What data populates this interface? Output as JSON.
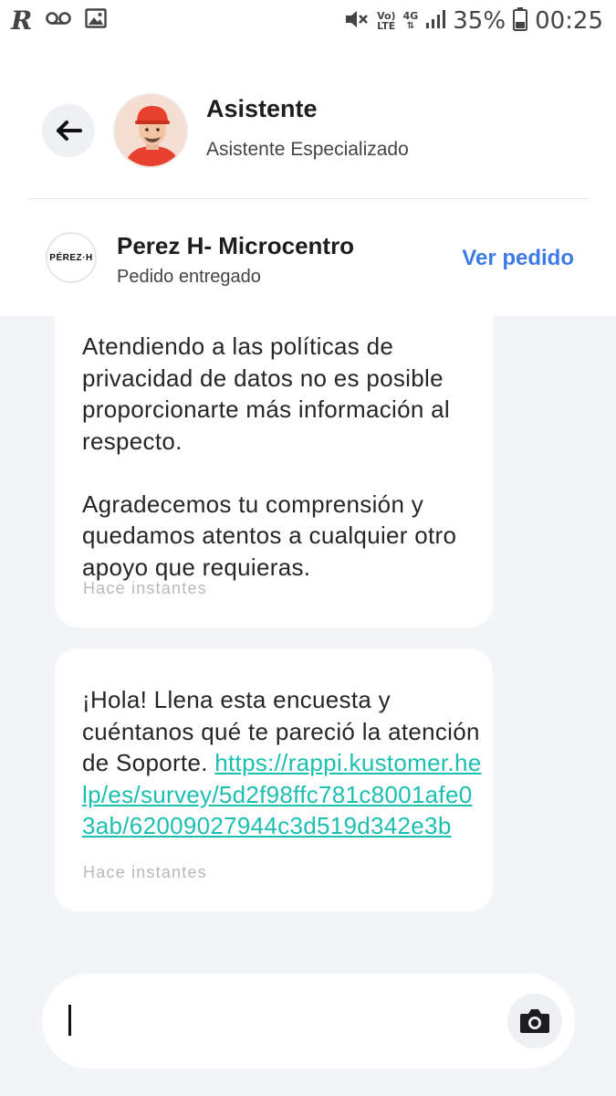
{
  "status_bar": {
    "battery": "35%",
    "time": "00:25",
    "network_4g": "4G",
    "volte_top": "Vo)",
    "volte_bottom": "LTE",
    "icons": [
      "rappi-r-icon",
      "voicemail-icon",
      "image-icon",
      "mute-icon",
      "volte-icon",
      "4g-icon",
      "signal-icon",
      "battery-icon"
    ]
  },
  "header": {
    "back_icon": "arrow-left-icon",
    "assistant_name": "Asistente",
    "assistant_subtitle": "Asistente Especializado",
    "store_logo_text": "PÉREZ·H",
    "store_name": "Perez H- Microcentro",
    "order_status": "Pedido entregado",
    "view_order_label": "Ver pedido"
  },
  "messages": [
    {
      "text": "Atendiendo a las políticas de privacidad de datos no es posible proporcionarte más información al respecto.\n\nAgradecemos tu comprensión y quedamos atentos a cualquier otro apoyo que requieras.",
      "time": "Hace instantes"
    },
    {
      "text": "¡Hola! Llena esta encuesta y cuéntanos qué te pareció la atención de Soporte. ",
      "link": "https://rappi.kustomer.help/es/survey/5d2f98ffc781c8001afe03ab/62009027944c3d519d342e3b",
      "time": "Hace instantes"
    }
  ],
  "composer": {
    "value": "",
    "camera_icon": "camera-icon"
  },
  "colors": {
    "accent_blue": "#3e7be8",
    "link_teal": "#1bbfb0",
    "background": "#f3f4f7"
  }
}
